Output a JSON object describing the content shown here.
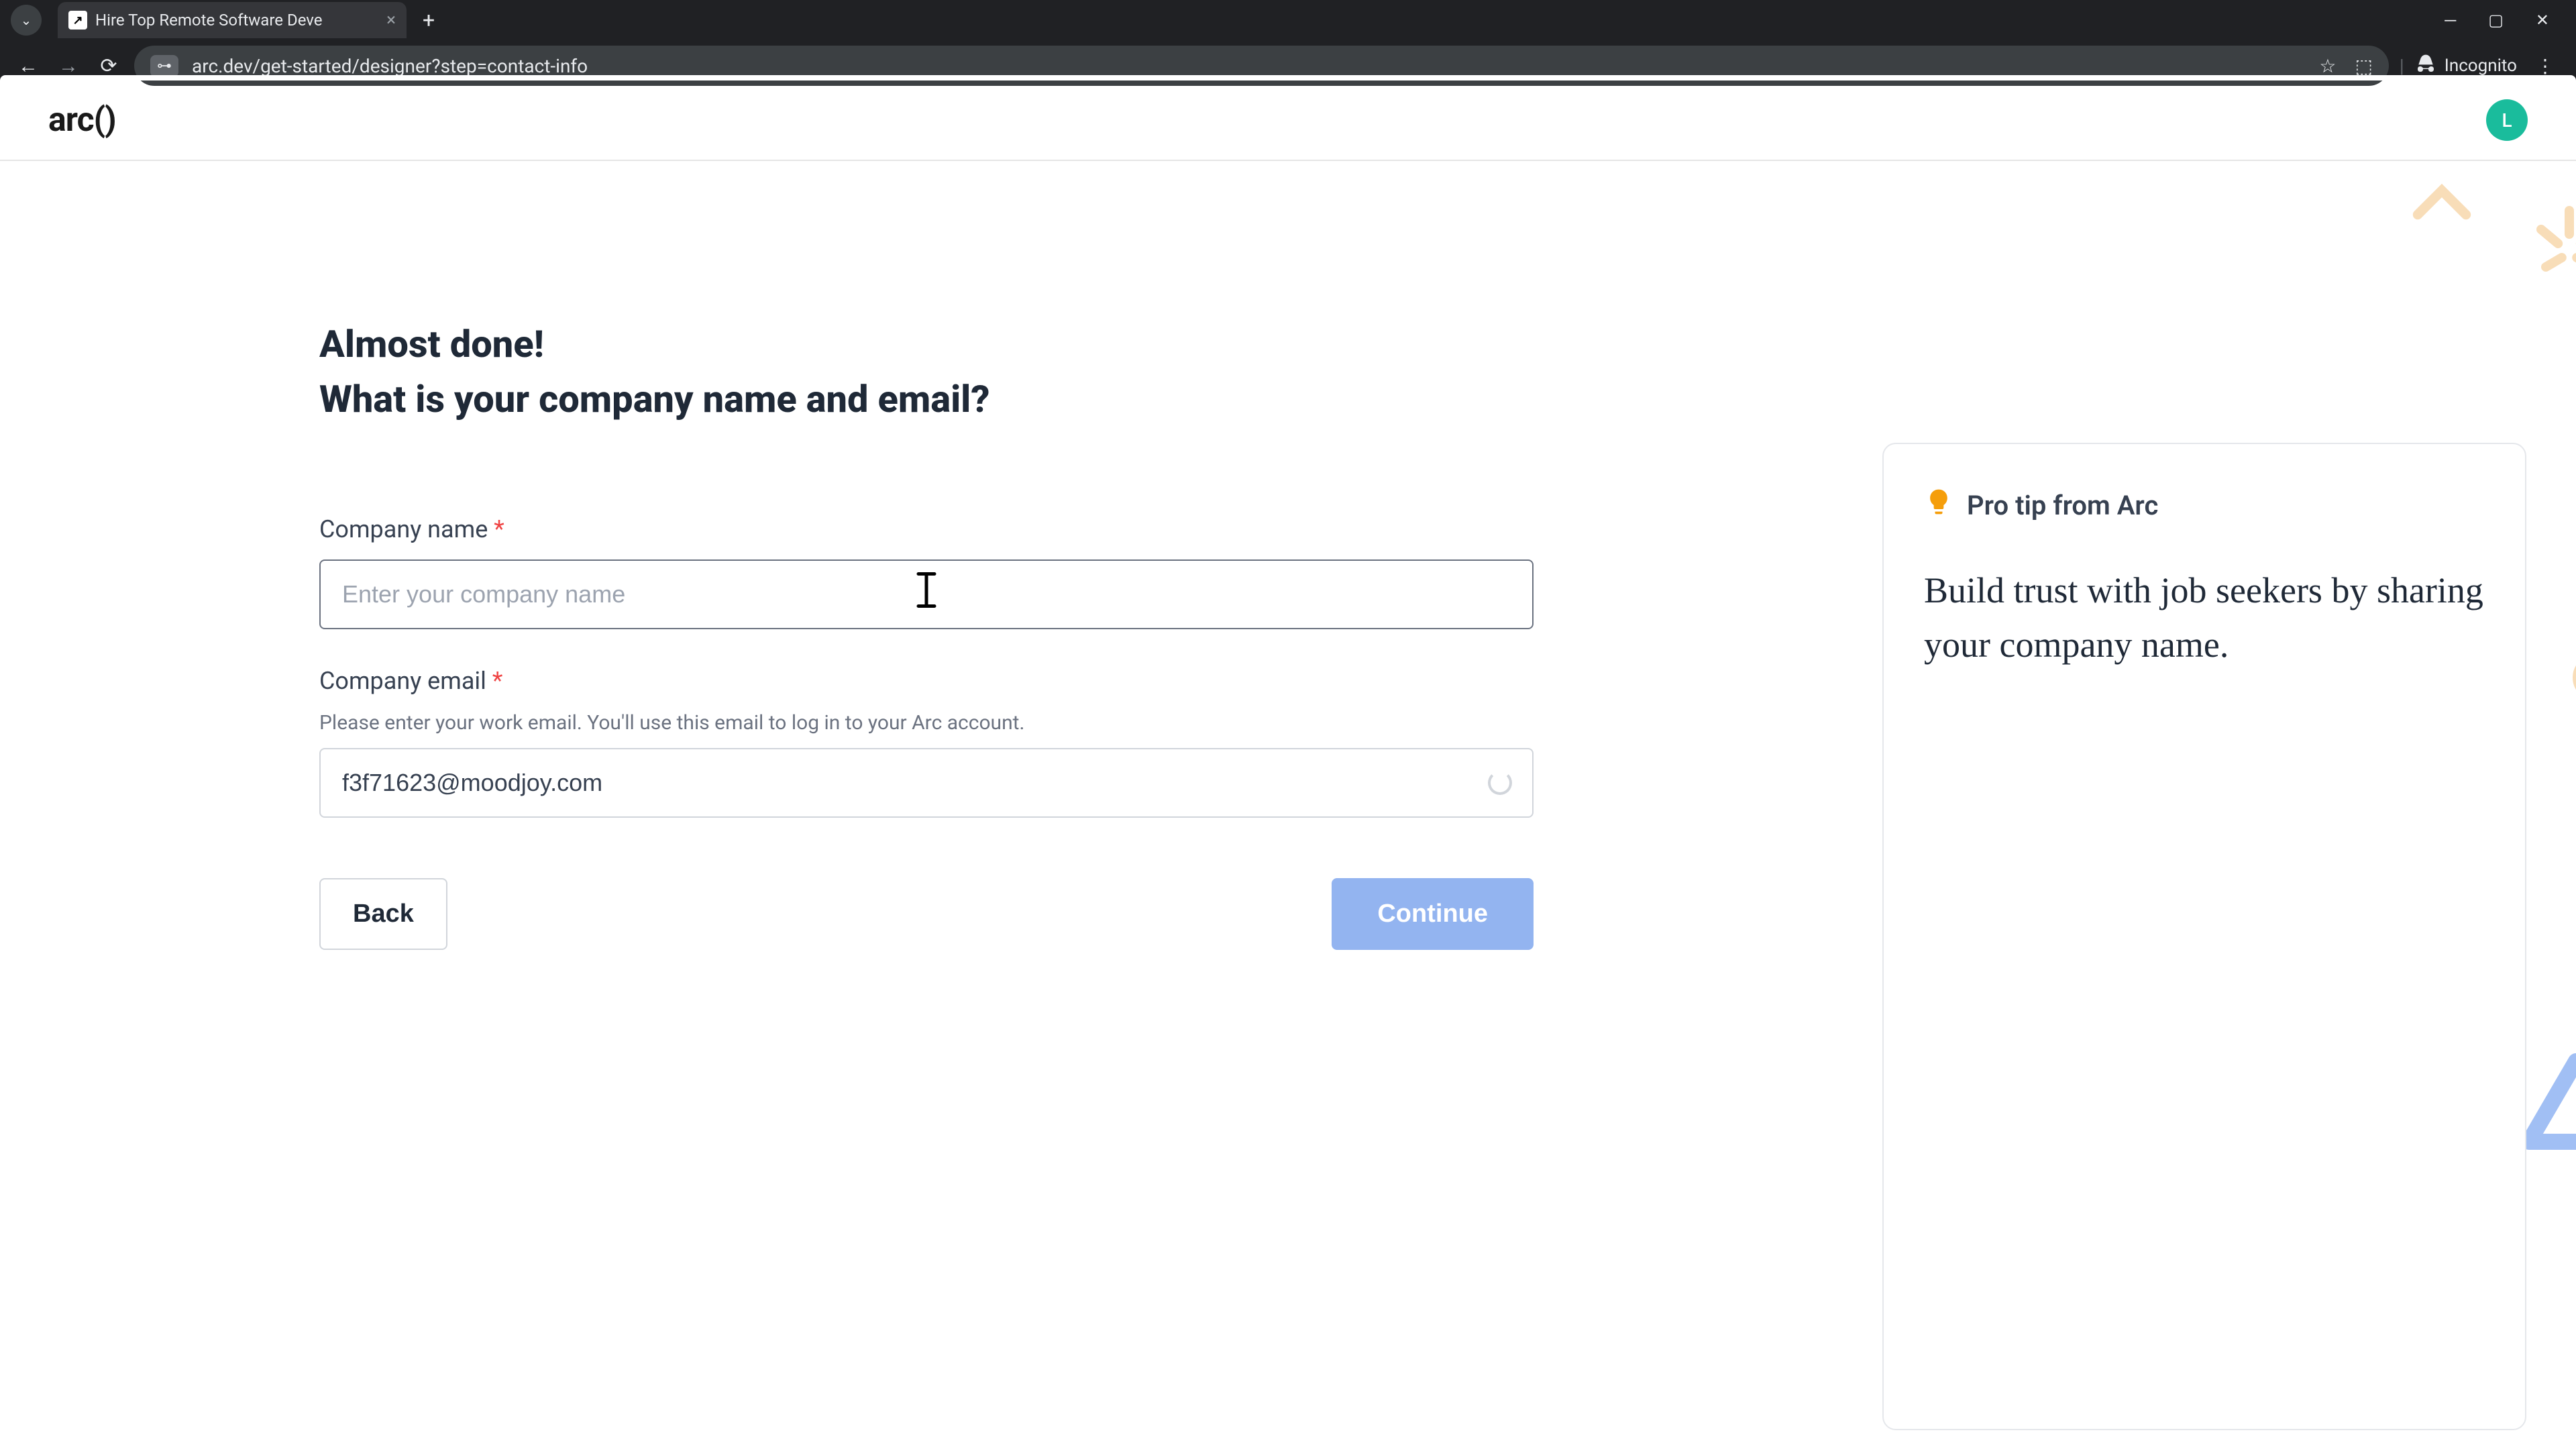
{
  "browser": {
    "tab_title": "Hire Top Remote Software Deve",
    "url": "arc.dev/get-started/designer?step=contact-info",
    "incognito_label": "Incognito"
  },
  "header": {
    "logo": "arc()",
    "avatar_initial": "L"
  },
  "form": {
    "heading_line1": "Almost done!",
    "heading_line2": "What is your company name and email?",
    "company_name": {
      "label": "Company name",
      "placeholder": "Enter your company name",
      "value": ""
    },
    "company_email": {
      "label": "Company email",
      "hint": "Please enter your work email. You'll use this email to log in to your Arc account.",
      "value": "f3f71623@moodjoy.com"
    },
    "back_button": "Back",
    "continue_button": "Continue"
  },
  "tip": {
    "icon": "💡",
    "title": "Pro tip from Arc",
    "body": "Build trust with job seekers by sharing your company name."
  }
}
